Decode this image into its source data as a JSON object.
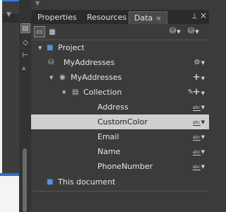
{
  "tabs": [
    {
      "label": "Properties",
      "active": false
    },
    {
      "label": "Resources",
      "active": false
    },
    {
      "label": "Data",
      "active": true
    }
  ],
  "tree": {
    "project_label": "Project",
    "data_source": "MyAddresses",
    "object": "MyAddresses",
    "collection": "Collection",
    "fields": [
      "Address",
      "CustomColor",
      "Email",
      "Name",
      "PhoneNumber"
    ],
    "selected_field": "CustomColor",
    "this_document": "This document"
  },
  "icons": {
    "tab_close": "×",
    "pin": "pin-icon",
    "window_close": "close-icon",
    "list_mode": "list-mode-icon",
    "details_mode": "details-mode-icon",
    "create_data_source": "create-data-source-icon",
    "create_sample_data": "create-sample-data-icon",
    "field_type": "abc"
  },
  "colors": {
    "panel_bg": "#3b3b3b",
    "selected_row_bg": "#cfcfcf",
    "accent_blue": "#5b8fe0"
  }
}
